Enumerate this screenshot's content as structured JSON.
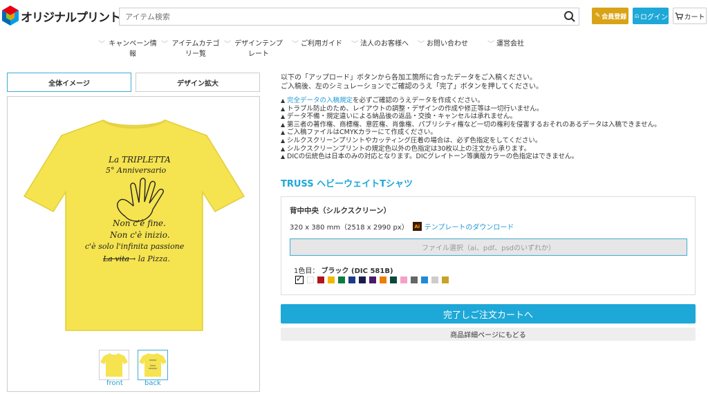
{
  "header": {
    "logo_text": "オリジナルプリント.jp",
    "search_placeholder": "アイテム検索",
    "member_label": "会員登録",
    "login_label": "ログイン",
    "cart_label": "カート"
  },
  "nav": [
    {
      "label": "キャンペーン情報"
    },
    {
      "label": "アイテムカテゴリー覧"
    },
    {
      "label": "デザインテンプレート"
    },
    {
      "label": "ご利用ガイド"
    },
    {
      "label": "法人のお客様へ"
    },
    {
      "label": "お問い合わせ"
    },
    {
      "label": "運営会社"
    }
  ],
  "preview": {
    "tab_all": "全体イメージ",
    "tab_zoom": "デザイン拡大",
    "print_lines": [
      "La TRIPLETTA",
      "5° Anniversario",
      "Non c'è fine.",
      "Non c'è inizio.",
      "c'è solo l'infinita passione",
      "La vita",
      "→ la Pizza."
    ],
    "thumb_front": "front",
    "thumb_back": "back",
    "shirt_color": "#f5e34f"
  },
  "instructions": [
    "以下の「アップロード」ボタンから各加工箇所に合ったデータをご入稿ください。",
    "ご入稿後、左のシミュレーションでご確認のうえ「完了」ボタンを押してください。"
  ],
  "notices": {
    "first_link": "完全データの入稿規定",
    "first_rest": "を必ずご確認のうえデータを作成ください。",
    "rows": [
      "トラブル防止のため、レイアウトの調整・デザインの作成や修正等は一切行いません。",
      "データ不備・規定違いによる納品後の返品・交換・キャンセルは承れません。",
      "第三者の著作権、商標権、意匠権、肖像権、パブリシティ権など一切の権利を侵害するおそれのあるデータは入稿できません。",
      "ご入稿ファイルはCMYKカラーにて作成ください。",
      "シルクスクリーンプリントやカッティング圧着の場合は、必ず色指定をしてください。",
      "シルクスクリーンプリントの規定色以外の色指定は30枚以上の注文から承ります。",
      "DICの伝統色は日本のみの対応となります。DICグレイトーン等廣版カラーの色指定はできません。"
    ]
  },
  "product": {
    "title": "TRUSS ヘビーウェイトTシャツ"
  },
  "upload": {
    "area_title": "背中中央（シルクスクリーン）",
    "size": "320 x 380 mm（2518 x 2990 px）",
    "template_link": "テンプレートのダウンロード",
    "file_button": "ファイル選択（ai、pdf、psdのいずれか）",
    "color_prefix": "1色目：",
    "color_name": "ブラック (DIC 581B)",
    "swatches": [
      "#000000",
      "#ffffff",
      "#b0141e",
      "#f2b705",
      "#0d7a3e",
      "#1f3a8a",
      "#1b1b4d",
      "#4a1a6b",
      "#ef7d00",
      "#0b4a3a",
      "#f5a0c8",
      "#666666",
      "#1e8bd6",
      "#cccccc",
      "#c9a227"
    ]
  },
  "actions": {
    "complete_label": "完了しご注文カートへ",
    "back_label": "商品詳細ページにもどる"
  },
  "colors": {
    "accent": "#1ea8d8",
    "member": "#d9a317"
  }
}
